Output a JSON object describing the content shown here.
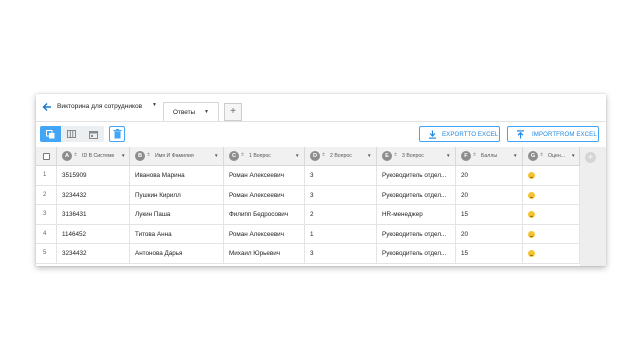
{
  "header": {
    "title": "Викторина для сотрудников",
    "tab_label": "Ответы",
    "add_tab": "+"
  },
  "toolbar": {
    "export_label": "EXPORTTO EXCEL",
    "import_label": "IMPORTFROM EXCEL"
  },
  "columns": [
    {
      "badge": "A",
      "label": "ID В Системе"
    },
    {
      "badge": "B",
      "label": "Имя И Фамилия"
    },
    {
      "badge": "C",
      "label": "1 Вопрос"
    },
    {
      "badge": "D",
      "label": "2 Вопрос"
    },
    {
      "badge": "E",
      "label": "3 Вопрос"
    },
    {
      "badge": "F",
      "label": "Баллы"
    },
    {
      "badge": "G",
      "label": "Оцен..."
    }
  ],
  "rows": [
    {
      "n": "1",
      "id": "3515909",
      "name": "Иванова Марина",
      "q1": "Роман Алексеевич",
      "q2": "3",
      "q3": "Руководитель отдел...",
      "score": "20"
    },
    {
      "n": "2",
      "id": "3234432",
      "name": "Пушкин Кирилл",
      "q1": "Роман Алексеевич",
      "q2": "3",
      "q3": "Руководитель отдел...",
      "score": "20"
    },
    {
      "n": "3",
      "id": "3136431",
      "name": "Лукин Паша",
      "q1": "Филипп Бедросович",
      "q2": "2",
      "q3": "HR-менеджер",
      "score": "15"
    },
    {
      "n": "4",
      "id": "1146452",
      "name": "Титова Анна",
      "q1": "Роман Алексеевич",
      "q2": "1",
      "q3": "Руководитель отдел...",
      "score": "20"
    },
    {
      "n": "5",
      "id": "3234432",
      "name": "Антонова Дарья",
      "q1": "Михаил Юрьевич",
      "q2": "3",
      "q3": "Руководитель отдел...",
      "score": "15"
    }
  ],
  "icons": {
    "back": "arrow-left-icon",
    "views": [
      "copy-icon",
      "grid-icon",
      "calendar-icon"
    ],
    "delete": "trash-icon",
    "export": "download-icon",
    "import": "upload-icon",
    "rating": "smiley-icon",
    "add_column": "plus-icon"
  },
  "colors": {
    "accent": "#1e88e5",
    "active_view": "#42a5f5",
    "header_bg": "#f1f1f1",
    "badge": "#8d8d8d"
  }
}
